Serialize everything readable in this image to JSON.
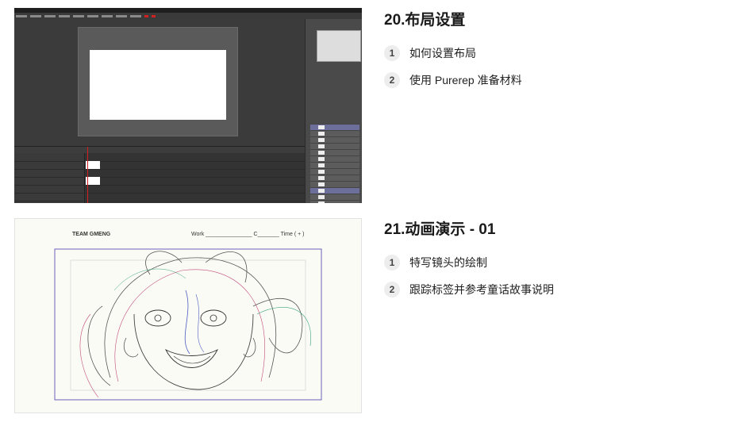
{
  "lessons": [
    {
      "title": "20.布局设置",
      "items": [
        {
          "num": "1",
          "label": "如何设置布局"
        },
        {
          "num": "2",
          "label": "使用 Purerep 准备材料"
        }
      ]
    },
    {
      "title": "21.动画演示 - 01",
      "items": [
        {
          "num": "1",
          "label": "特写镜头的绘制"
        },
        {
          "num": "2",
          "label": "跟踪标签并参考童话故事说明"
        }
      ]
    }
  ],
  "sketch": {
    "team_label": "TEAM GMENG",
    "fields_label": "Work _______________   C_______   Time ( + )"
  },
  "colors": {
    "software_bg": "#2e2e2e",
    "selected_layer": "#6b6f9a",
    "playhead": "#d02020",
    "sketch_frame": "#6a60b8"
  }
}
